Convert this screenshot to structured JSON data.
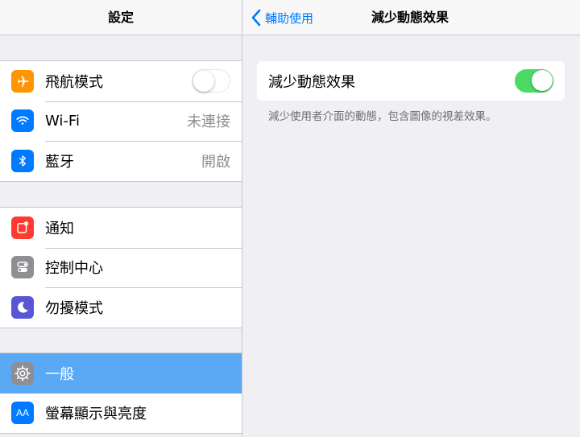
{
  "master": {
    "title": "設定",
    "groups": [
      [
        {
          "label": "飛航模式",
          "icon": "airplane-icon",
          "color": "#ff9500",
          "control": "toggle-off"
        },
        {
          "label": "Wi-Fi",
          "icon": "wifi-icon",
          "color": "#007aff",
          "value": "未連接"
        },
        {
          "label": "藍牙",
          "icon": "bluetooth-icon",
          "color": "#007aff",
          "value": "開啟"
        }
      ],
      [
        {
          "label": "通知",
          "icon": "notifications-icon",
          "color": "#ff3b30"
        },
        {
          "label": "控制中心",
          "icon": "control-center-icon",
          "color": "#8e8e93"
        },
        {
          "label": "勿擾模式",
          "icon": "moon-icon",
          "color": "#5856d6"
        }
      ],
      [
        {
          "label": "一般",
          "icon": "gear-icon",
          "color": "#8e8e93",
          "selected": true
        },
        {
          "label": "螢幕顯示與亮度",
          "icon": "display-brightness-icon",
          "color": "#007aff",
          "icon_text": "AA"
        }
      ]
    ]
  },
  "detail": {
    "back_label": "輔助使用",
    "title": "減少動態效果",
    "setting_label": "減少動態效果",
    "setting_on": true,
    "footnote": "減少使用者介面的動態，包含圖像的視差效果。"
  },
  "colors": {
    "accent": "#007aff",
    "toggle_on": "#4cd964",
    "selected_row": "#5aa9f5",
    "background": "#efeff4"
  }
}
